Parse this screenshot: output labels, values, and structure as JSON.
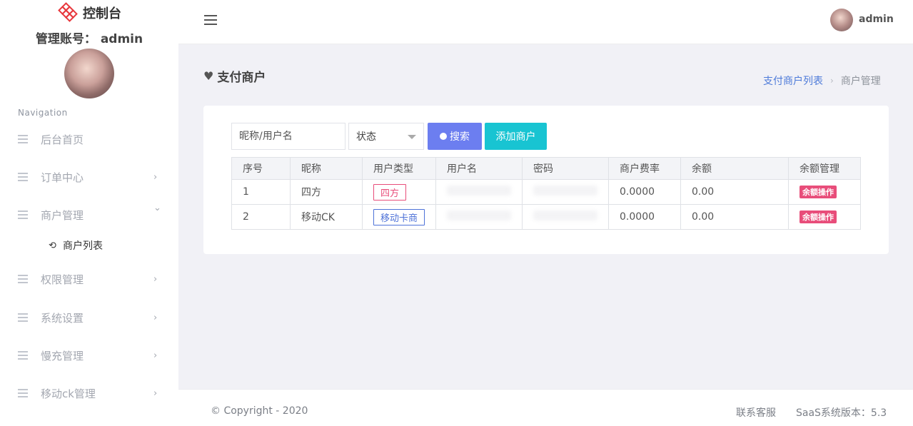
{
  "brand": {
    "title": "控制台",
    "logo_icon": "knot-logo-icon",
    "logo_color": "#e8383d"
  },
  "account": {
    "label": "管理账号：",
    "name": "admin"
  },
  "nav": {
    "heading": "Navigation",
    "items": [
      {
        "label": "后台首页",
        "arrow": ""
      },
      {
        "label": "订单中心",
        "arrow": "›"
      },
      {
        "label": "商户管理",
        "arrow": "⌄"
      },
      {
        "label": "权限管理",
        "arrow": "›"
      },
      {
        "label": "系统设置",
        "arrow": "›"
      },
      {
        "label": "慢充管理",
        "arrow": "›"
      },
      {
        "label": "移动ck管理",
        "arrow": "›"
      }
    ],
    "subitem": {
      "label": "商户列表",
      "icon": "refresh-icon"
    }
  },
  "topbar": {
    "user_name": "admin",
    "menu_icon": "hamburger-menu-icon"
  },
  "page": {
    "title": "支付商户",
    "title_icon": "heart-icon",
    "breadcrumb": {
      "link": "支付商户列表",
      "separator": "›",
      "current": "商户管理"
    }
  },
  "filters": {
    "search_placeholder": "昵称/用户名",
    "status_value": "状态",
    "search_button": "搜索",
    "add_button": "添加商户"
  },
  "table": {
    "headers": [
      "序号",
      "昵称",
      "用户类型",
      "用户名",
      "密码",
      "商户费率",
      "余额",
      "余额管理"
    ],
    "rows": [
      {
        "id": "1",
        "nickname": "四方",
        "type": "四方",
        "username": "",
        "password": "",
        "rate": "0.0000",
        "balance": "0.00",
        "action": "余额操作"
      },
      {
        "id": "2",
        "nickname": "移动CK",
        "type": "移动卡商",
        "username": "",
        "password": "",
        "rate": "0.0000",
        "balance": "0.00",
        "action": "余额操作"
      }
    ]
  },
  "footer": {
    "copyright": "© Copyright - 2020",
    "support": "联系客服",
    "version": "SaaS系统版本：5.3"
  },
  "colors": {
    "accent_blue": "#6c7ef0",
    "accent_cyan": "#18c4d2",
    "accent_pink": "#e84d7a",
    "link_blue": "#4e7bd9"
  }
}
